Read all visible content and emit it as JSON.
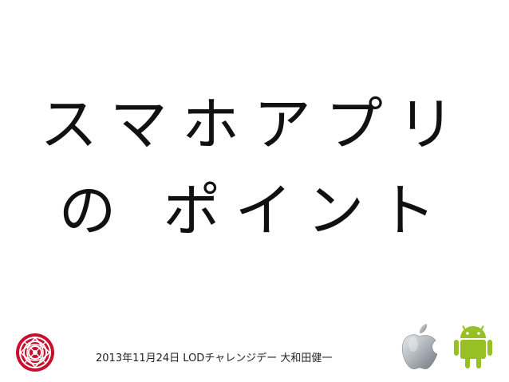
{
  "slide": {
    "title_line1": "スマホアプリ",
    "title_line2": "の ポイント",
    "footer": "2013年11月24日 LODチャレンジデー 大和田健一"
  },
  "icons": {
    "left_logo": "red-knot-emblem-icon",
    "apple": "apple-logo-icon",
    "android": "android-robot-icon"
  },
  "colors": {
    "title": "#111111",
    "emblem": "#c8102e",
    "android": "#97c024",
    "apple": "#a0a6ad"
  }
}
